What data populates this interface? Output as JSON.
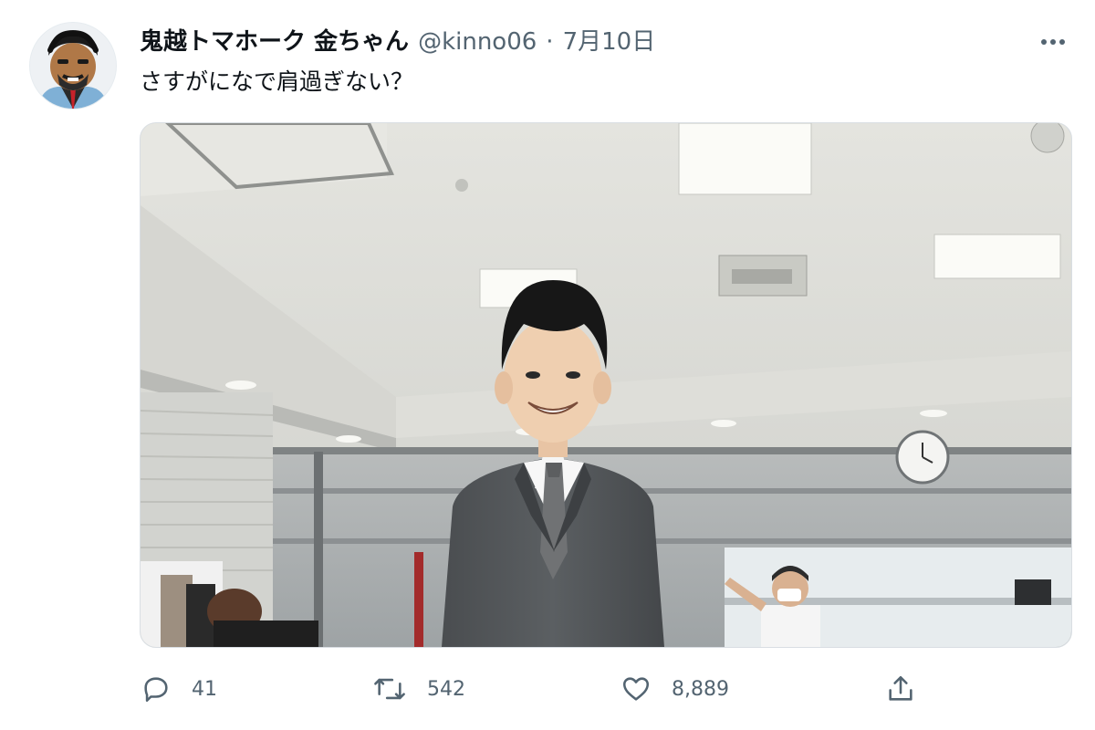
{
  "tweet": {
    "author": {
      "display_name": "鬼越トマホーク 金ちゃん",
      "handle": "@kinno06",
      "separator": "·",
      "date": "7月10日"
    },
    "text": "さすがになで肩過ぎない？",
    "more_icon": "more-horizontal-icon"
  },
  "actions": {
    "reply": {
      "icon": "reply-icon",
      "count": "41"
    },
    "retweet": {
      "icon": "retweet-icon",
      "count": "542"
    },
    "like": {
      "icon": "heart-icon",
      "count": "8,889"
    },
    "share": {
      "icon": "share-icon"
    }
  },
  "colors": {
    "primary_text": "#0f1419",
    "secondary_text": "#536471",
    "border": "#d9dee3"
  }
}
